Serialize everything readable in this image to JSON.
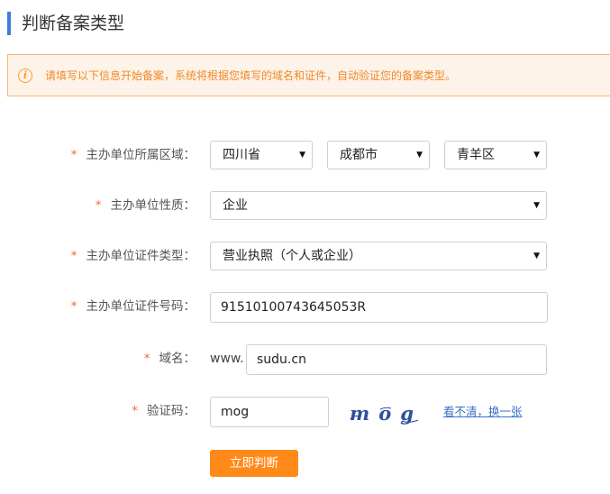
{
  "page": {
    "title": "判断备案类型"
  },
  "notice": {
    "text": "请填写以下信息开始备案，系统将根据您填写的域名和证件，自动验证您的备案类型。"
  },
  "form": {
    "required_mark": "*",
    "region": {
      "label": "主办单位所属区域：",
      "province": "四川省",
      "city": "成都市",
      "district": "青羊区"
    },
    "nature": {
      "label": "主办单位性质：",
      "value": "企业"
    },
    "cert_type": {
      "label": "主办单位证件类型：",
      "value": "营业执照（个人或企业）"
    },
    "cert_number": {
      "label": "主办单位证件号码：",
      "value": "91510100743645053R"
    },
    "domain": {
      "label": "域名：",
      "prefix": "www.",
      "value": "sudu.cn"
    },
    "captcha": {
      "label": "验证码：",
      "value": "mog",
      "image_text": "mog",
      "refresh_link": "看不清，换一张"
    },
    "submit_label": "立即判断"
  },
  "icons": {
    "notice": "info-icon",
    "dropdown": "caret-down-icon"
  },
  "colors": {
    "accent": "#ff8a1a",
    "title_bar": "#3d7fd9",
    "notice_bg": "#fdf3e8",
    "notice_border": "#f5b97a",
    "required_star": "#f06b2b",
    "link": "#3a6fc6",
    "captcha_ink": "#2f4f9a"
  }
}
